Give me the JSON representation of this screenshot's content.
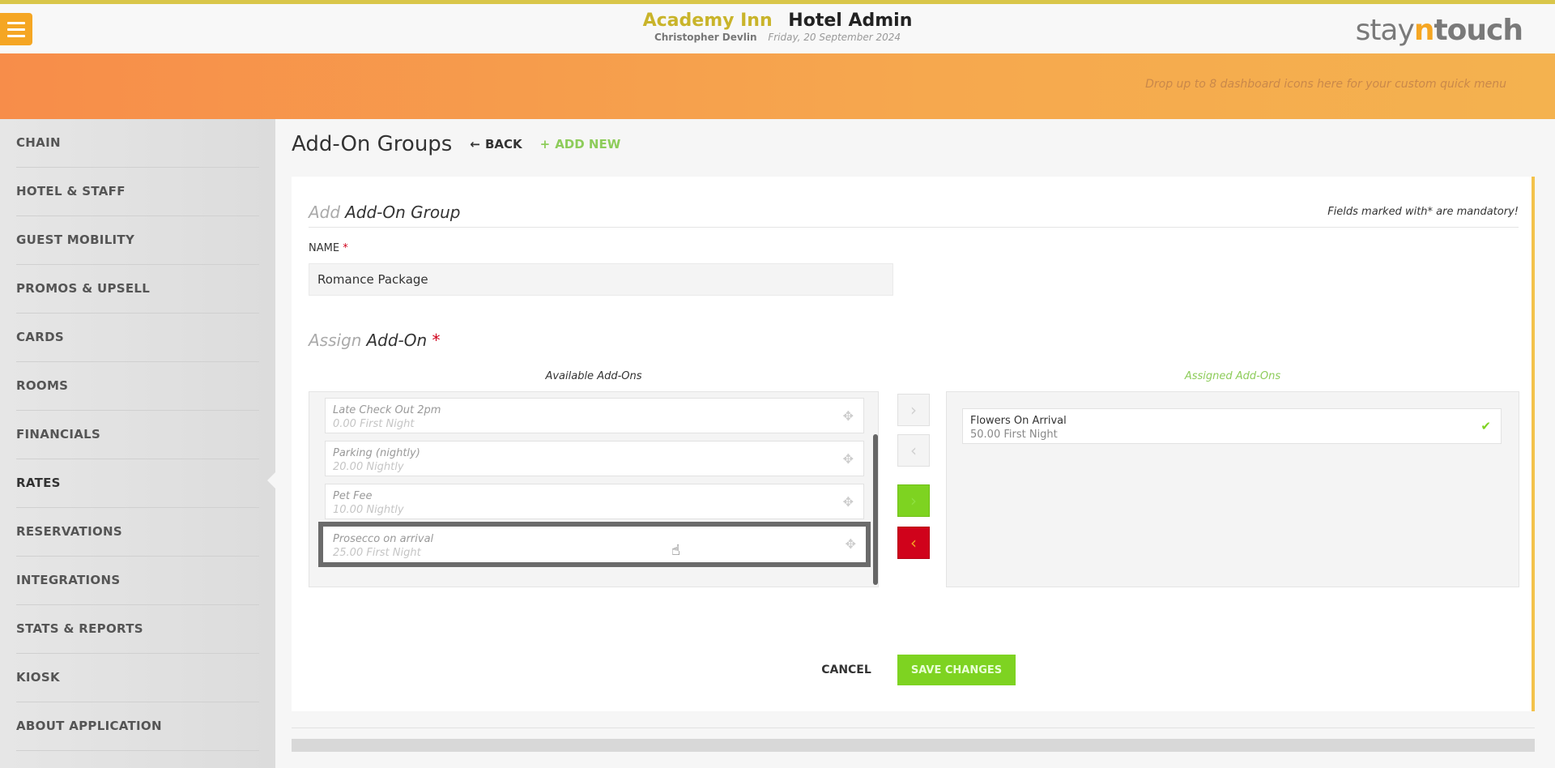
{
  "header": {
    "hotel_name": "Academy Inn",
    "app_name": "Hotel Admin",
    "user": "Christopher Devlin",
    "date": "Friday, 20 September 2024",
    "logo_part1": "stay",
    "logo_part2": "n",
    "logo_part3": "touch",
    "quick_menu_hint": "Drop up to 8 dashboard icons here for your custom quick menu"
  },
  "sidebar": {
    "items": [
      {
        "label": "CHAIN"
      },
      {
        "label": "HOTEL & STAFF"
      },
      {
        "label": "GUEST MOBILITY"
      },
      {
        "label": "PROMOS & UPSELL"
      },
      {
        "label": "CARDS"
      },
      {
        "label": "ROOMS"
      },
      {
        "label": "FINANCIALS"
      },
      {
        "label": "RATES"
      },
      {
        "label": "RESERVATIONS"
      },
      {
        "label": "INTEGRATIONS"
      },
      {
        "label": "STATS & REPORTS"
      },
      {
        "label": "KIOSK"
      },
      {
        "label": "ABOUT APPLICATION"
      }
    ],
    "active": "RATES"
  },
  "page": {
    "title": "Add-On Groups",
    "back_label": "BACK",
    "add_new_label": "ADD NEW"
  },
  "form": {
    "heading_light": "Add",
    "heading_dark": "Add-On Group",
    "mandatory_note": "Fields marked with* are mandatory!",
    "name_label": "NAME",
    "required_mark": "*",
    "name_value": "Romance Package",
    "assign_light": "Assign",
    "assign_dark": "Add-On",
    "available_title": "Available Add-Ons",
    "assigned_title": "Assigned Add-Ons",
    "available": [
      {
        "name": "Late Check Out 2pm",
        "price": "0.00 First Night"
      },
      {
        "name": "Parking (nightly)",
        "price": "20.00 Nightly"
      },
      {
        "name": "Pet Fee",
        "price": "10.00 Nightly"
      },
      {
        "name": "Prosecco on arrival",
        "price": "25.00 First Night"
      }
    ],
    "assigned": [
      {
        "name": "Flowers On Arrival",
        "price": "50.00 First Night"
      }
    ],
    "cancel_label": "CANCEL",
    "save_label": "SAVE CHANGES"
  },
  "icons": {
    "menu": "hamburger-icon",
    "back": "arrow-left-icon",
    "add": "plus-icon",
    "drag": "move-icon",
    "check": "check-icon",
    "cursor": "hand-pointer-icon"
  },
  "colors": {
    "accent_orange": "#f5a623",
    "accent_green": "#7ed321",
    "danger_red": "#d0021b",
    "brand_gold": "#c9b42a"
  }
}
